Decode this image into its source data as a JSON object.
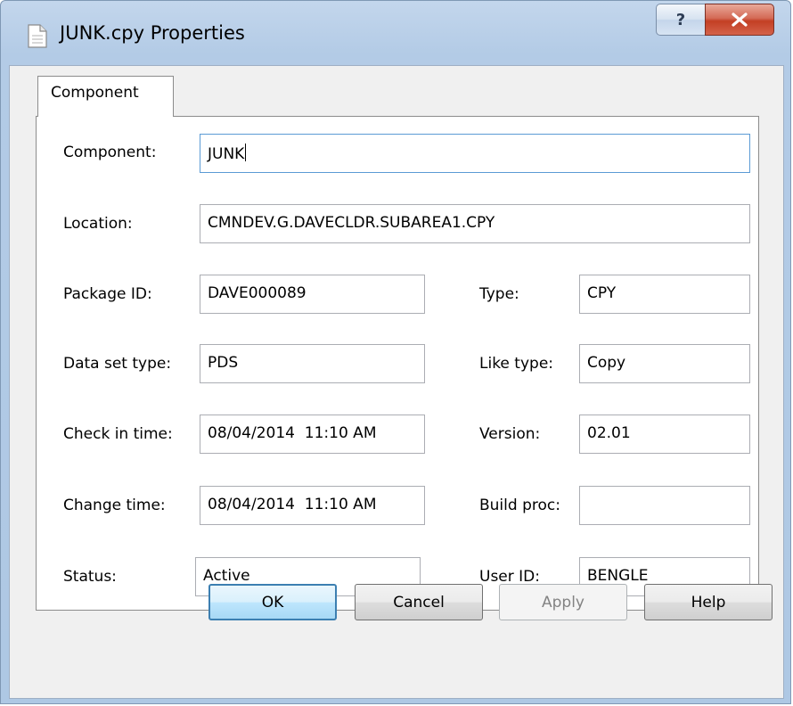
{
  "window": {
    "title": "JUNK.cpy Properties",
    "help_glyph": "?",
    "close_glyph": "X"
  },
  "tabs": [
    {
      "label": "Component",
      "selected": true
    }
  ],
  "form": {
    "component": {
      "label": "Component:",
      "value": "JUNK"
    },
    "location": {
      "label": "Location:",
      "value": "CMNDEV.G.DAVECLDR.SUBAREA1.CPY"
    },
    "package_id": {
      "label": "Package ID:",
      "value": "DAVE000089"
    },
    "type": {
      "label": "Type:",
      "value": "CPY"
    },
    "data_set_type": {
      "label": "Data set type:",
      "value": "PDS"
    },
    "like_type": {
      "label": "Like type:",
      "value": "Copy"
    },
    "check_in_time": {
      "label": "Check in time:",
      "value": "08/04/2014  11:10 AM"
    },
    "version": {
      "label": "Version:",
      "value": "02.01"
    },
    "change_time": {
      "label": "Change time:",
      "value": "08/04/2014  11:10 AM"
    },
    "build_proc": {
      "label": "Build proc:",
      "value": ""
    },
    "status": {
      "label": "Status:",
      "value": "Active"
    },
    "user_id": {
      "label": "User ID:",
      "value": "BENGLE"
    }
  },
  "buttons": {
    "ok": "OK",
    "cancel": "Cancel",
    "apply": "Apply",
    "help": "Help"
  },
  "colors": {
    "title_bar": "#b9d1ea",
    "close_button": "#c33f24",
    "default_button_border": "#3c7fb1"
  }
}
